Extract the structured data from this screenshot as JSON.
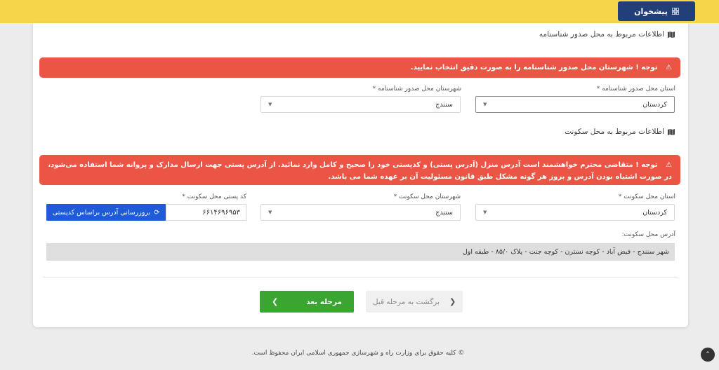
{
  "header": {
    "pishkhan_label": "پیشخوان"
  },
  "birth_section": {
    "title": "اطلاعات مربوط به محل صدور شناسنامه",
    "alert": "توجه ! شهرستان محل صدور شناسنامه را به صورت دقیق انتخاب نمایید.",
    "province_label": "استان محل صدور شناسنامه *",
    "province_value": "کردستان",
    "city_label": "شهرستان محل صدور شناسنامه *",
    "city_value": "سنندج"
  },
  "residence_section": {
    "title": "اطلاعات مربوط به محل سکونت",
    "alert": "توجه ! متقاضی محترم خواهشمند است آدرس منزل (آدرس پستی) و کدپستی خود را صحیح و کامل وارد نمائید. از آدرس پستی جهت ارسال مدارک و پروانه شما استفاده می‌شود، در صورت اشتباه بودن آدرس و بروز هر گونه مشکل طبق قانون مسئولیت آن بر عهده شما می باشد.",
    "province_label": "استان محل سکونت *",
    "province_value": "کردستان",
    "city_label": "شهرستان محل سکونت *",
    "city_value": "سنندج",
    "postal_label": "کد پستی محل سکونت *",
    "postal_value": "۶۶۱۴۶۹۶۹۵۳",
    "update_button": "بروزرسانی آدرس براساس کدپستی",
    "address_label": "آدرس محل سکونت:",
    "address_value": "شهر سنندج - فیض آباد - کوچه نسترن - کوچه جنت - پلاک ۸۵/۰ - طبقه اول"
  },
  "actions": {
    "next_label": "مرحله بعد",
    "back_label": "برگشت به مرحله قبل"
  },
  "footer": {
    "copyright": "© کلیه حقوق برای وزارت راه و شهرسازی جمهوری اسلامی ایران محفوظ است."
  },
  "colors": {
    "topbar": "#f7d54a",
    "alert": "#ea5545",
    "primary_blue": "#1d5bd8",
    "success_green": "#3aa530",
    "header_button": "#223f7a"
  }
}
